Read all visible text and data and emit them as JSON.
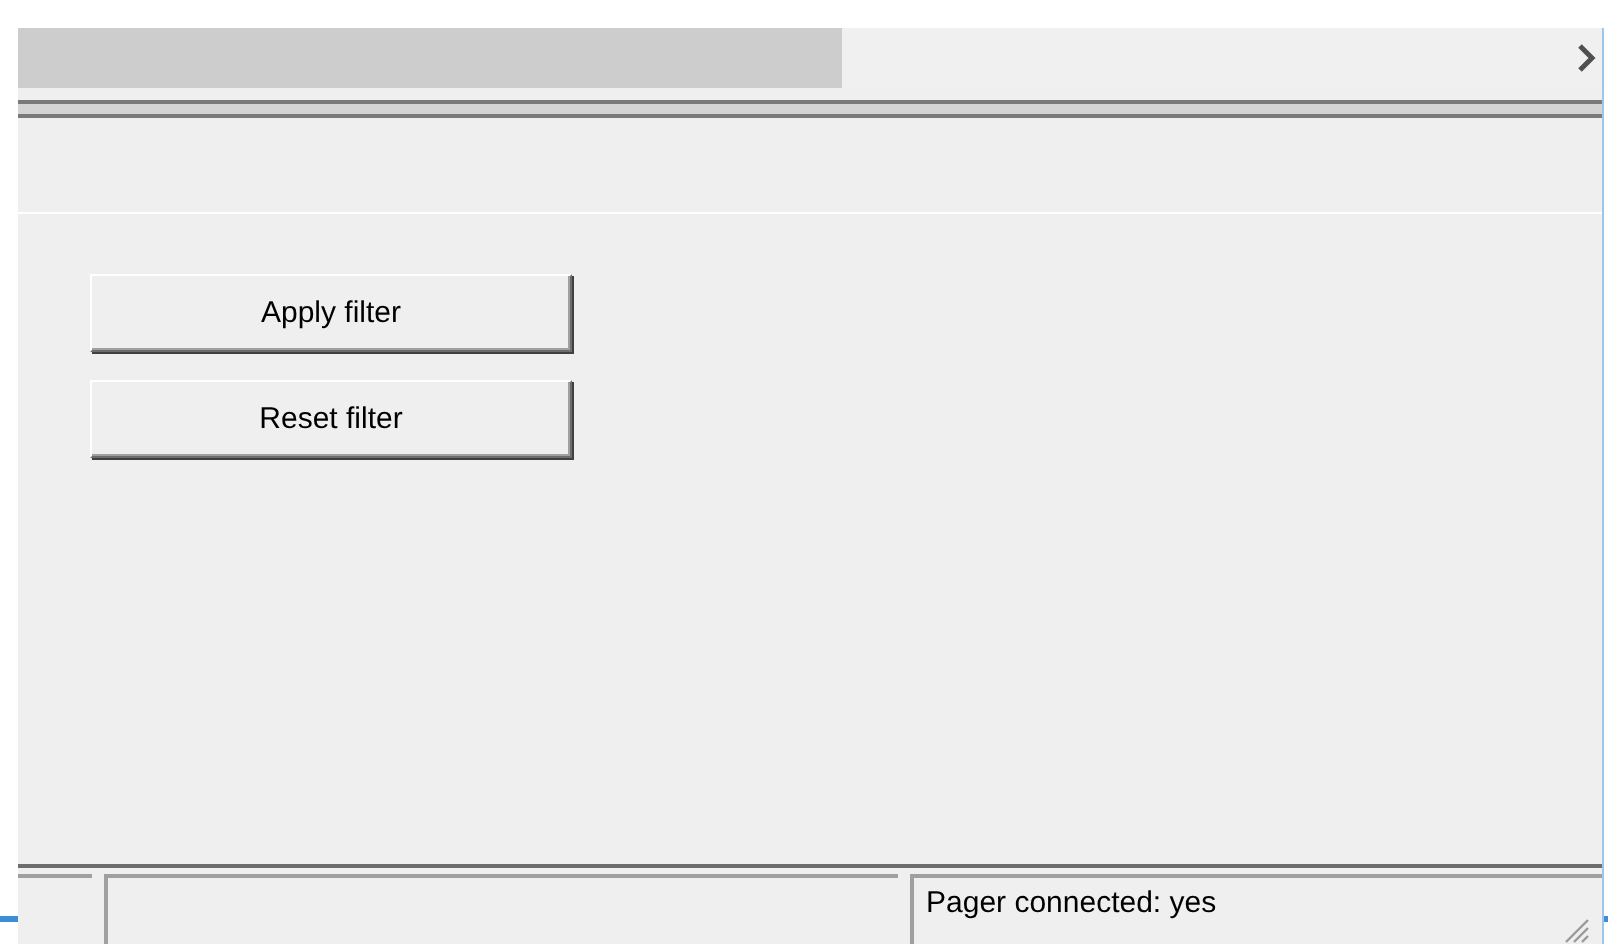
{
  "filter_buttons": [
    {
      "label": "Apply filter"
    },
    {
      "label": "Reset filter"
    }
  ],
  "status_bar": {
    "message": "Pager connected: yes"
  }
}
